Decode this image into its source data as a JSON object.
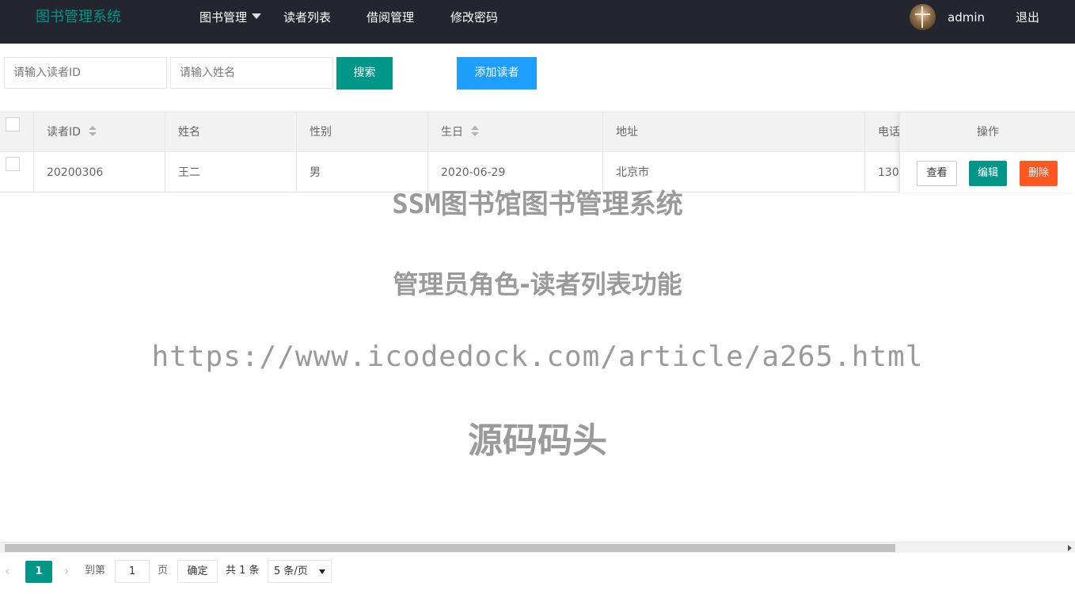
{
  "header": {
    "logo": "图书管理系统",
    "nav": [
      {
        "label": "图书管理"
      },
      {
        "label": "读者列表"
      },
      {
        "label": "借阅管理"
      },
      {
        "label": "修改密码"
      }
    ],
    "user_name": "admin",
    "logout": "退出"
  },
  "search": {
    "id_placeholder": "请输入读者ID",
    "name_placeholder": "请输入姓名",
    "search_label": "搜索",
    "add_label": "添加读者"
  },
  "table": {
    "columns": [
      "读者ID",
      "姓名",
      "性别",
      "生日",
      "地址",
      "电话",
      "操作"
    ],
    "rows": [
      {
        "id": "20200306",
        "name": "王二",
        "gender": "男",
        "birthday": "2020-06-29",
        "address": "北京市",
        "phone": "130"
      }
    ],
    "actions": {
      "view": "查看",
      "edit": "编辑",
      "delete": "删除"
    }
  },
  "watermark": {
    "line1": "SSM图书馆图书管理系统",
    "line2": "管理员角色-读者列表功能",
    "line3": "https://www.icodedock.com/article/a265.html",
    "line4": "源码码头"
  },
  "pager": {
    "prev": "‹",
    "current": "1",
    "next": "›",
    "goto_label": "到第",
    "goto_value": "1",
    "page_label": "页",
    "confirm": "确定",
    "total": "共 1 条",
    "page_size": "5 条/页"
  },
  "colors": {
    "header_bg": "#23262e",
    "accent": "#009688",
    "blue": "#1e9fff",
    "danger": "#ff5722"
  }
}
